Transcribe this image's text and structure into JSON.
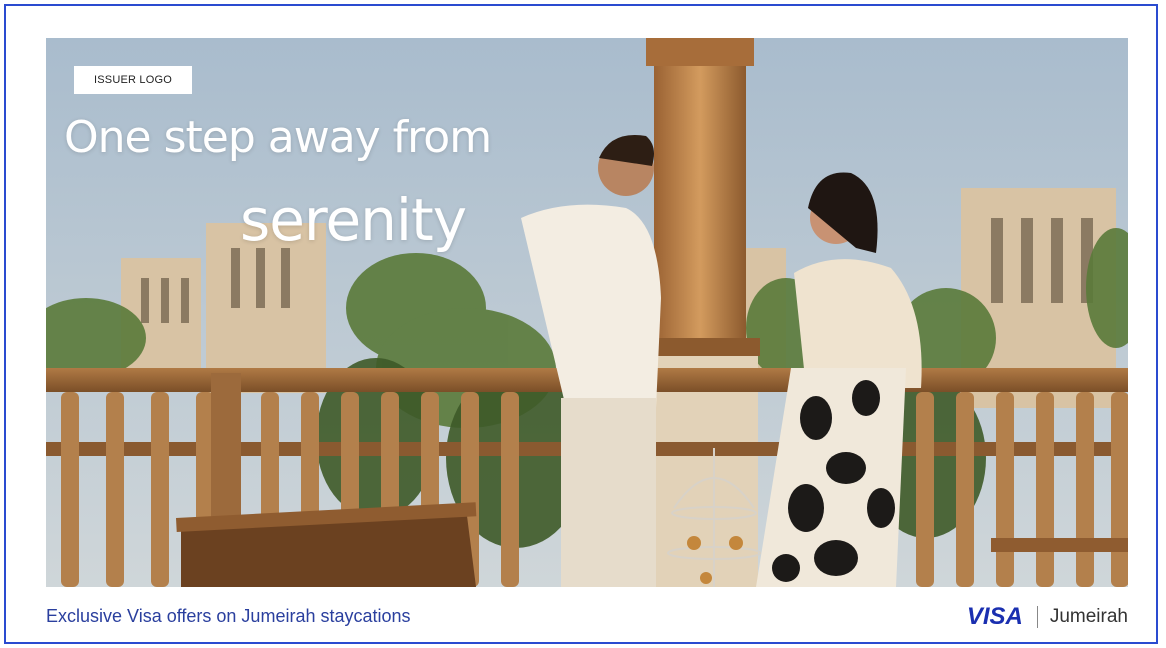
{
  "ad": {
    "issuer_logo": "ISSUER LOGO",
    "headline_line1": "One step away from",
    "headline_line2": "serenity",
    "tagline": "Exclusive Visa offers on Jumeirah staycations",
    "visa_logo": "VISA",
    "partner_logo": "Jumeirah"
  },
  "colors": {
    "frame_border": "#2a4bd0",
    "tagline": "#2a3f9e",
    "visa_blue": "#1a2fb0"
  }
}
